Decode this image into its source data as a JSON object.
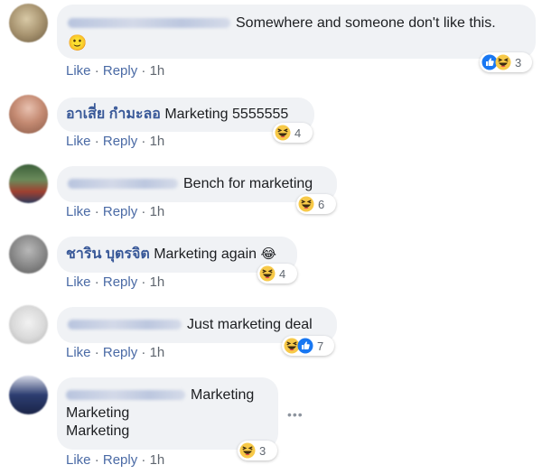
{
  "comments": [
    {
      "author": "",
      "text": "Somewhere and someone don't like this.",
      "emoji": "🙂",
      "actions": {
        "like": "Like",
        "sep": " · ",
        "reply": "Reply",
        "time": "1h"
      },
      "reactions": {
        "icons": [
          "like-reaction-icon",
          "haha-reaction-icon"
        ],
        "count": "3"
      }
    },
    {
      "author": "อาเสี่ย กำมะลอ",
      "text": "Marketing 5555555",
      "actions": {
        "like": "Like",
        "sep": " · ",
        "reply": "Reply",
        "time": "1h"
      },
      "reactions": {
        "icons": [
          "haha-reaction-icon"
        ],
        "count": "4"
      }
    },
    {
      "author": "",
      "text": "Bench for marketing",
      "actions": {
        "like": "Like",
        "sep": " · ",
        "reply": "Reply",
        "time": "1h"
      },
      "reactions": {
        "icons": [
          "haha-reaction-icon"
        ],
        "count": "6"
      }
    },
    {
      "author": "ชาริน บุตรจิต",
      "text": "Marketing again",
      "emoji": "😂",
      "actions": {
        "like": "Like",
        "sep": " · ",
        "reply": "Reply",
        "time": "1h"
      },
      "reactions": {
        "icons": [
          "haha-reaction-icon"
        ],
        "count": "4"
      }
    },
    {
      "author": "",
      "text": "Just marketing deal",
      "actions": {
        "like": "Like",
        "sep": " · ",
        "reply": "Reply",
        "time": "1h"
      },
      "reactions": {
        "icons": [
          "haha-reaction-icon",
          "like-reaction-icon"
        ],
        "count": "7"
      }
    },
    {
      "author": "",
      "text_lines": [
        "Marketing",
        "Marketing",
        "Marketing"
      ],
      "actions": {
        "like": "Like",
        "sep": " · ",
        "reply": "Reply",
        "time": "1h"
      },
      "reactions": {
        "icons": [
          "haha-reaction-icon"
        ],
        "count": "3"
      }
    }
  ],
  "colors": {
    "bubble": "#f0f2f5",
    "name": "#385898",
    "link": "#4a6aa5",
    "like_blue": "#1877f2",
    "haha_yellow": "#f7c948"
  }
}
